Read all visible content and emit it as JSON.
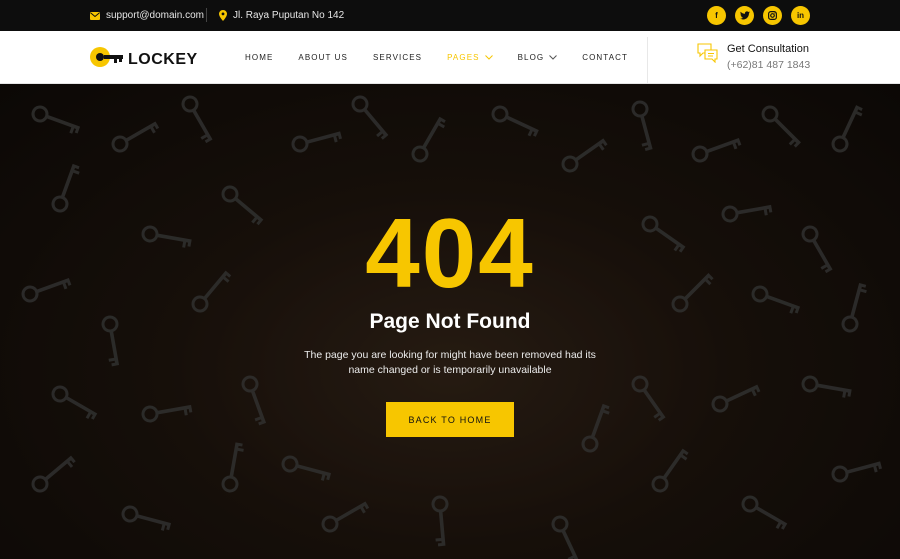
{
  "topbar": {
    "email": "support@domain.com",
    "address": "Jl. Raya Puputan No 142",
    "socials": [
      {
        "icon": "facebook-icon",
        "glyph": "f"
      },
      {
        "icon": "twitter-icon",
        "glyph": "t"
      },
      {
        "icon": "instagram-icon",
        "glyph": "◎"
      },
      {
        "icon": "linkedin-icon",
        "glyph": "in"
      }
    ]
  },
  "header": {
    "logo_text": "LOCKEY",
    "nav": [
      {
        "label": "HOME"
      },
      {
        "label": "ABOUT US"
      },
      {
        "label": "SERVICES"
      },
      {
        "label": "PAGES"
      },
      {
        "label": "BLOG"
      },
      {
        "label": "CONTACT"
      }
    ],
    "consult_title": "Get Consultation",
    "consult_phone": "(+62)81 487 1843"
  },
  "hero": {
    "code": "404",
    "title": "Page Not Found",
    "description": "The page you are looking for might have been removed had its name changed or is temporarily unavailable",
    "button_label": "BACK TO HOME"
  },
  "colors": {
    "accent": "#f7c600",
    "topbar_bg": "#0d0d0d",
    "header_bg": "#ffffff"
  }
}
